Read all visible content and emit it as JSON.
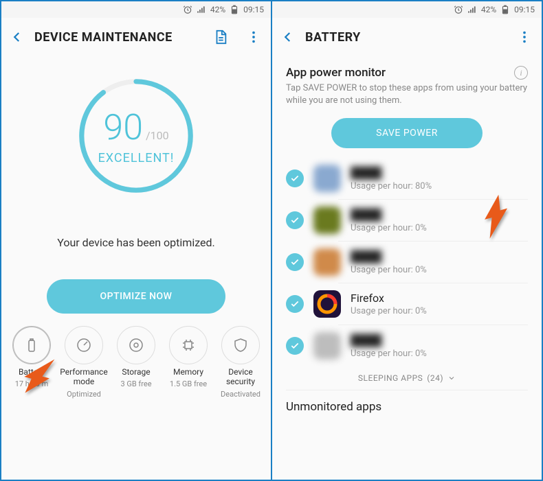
{
  "statusbar": {
    "battery_pct": "42%",
    "time": "09:15"
  },
  "left": {
    "title": "DEVICE MAINTENANCE",
    "score": "90",
    "score_max": "/100",
    "score_label": "EXCELLENT!",
    "optimized_msg": "Your device has been optimized.",
    "optimize_btn": "OPTIMIZE NOW",
    "categories": [
      {
        "label": "Battery",
        "sub": "17 h 10 m"
      },
      {
        "label": "Performance mode",
        "sub": "Optimized"
      },
      {
        "label": "Storage",
        "sub": "3 GB free"
      },
      {
        "label": "Memory",
        "sub": "1.5 GB free"
      },
      {
        "label": "Device security",
        "sub": "Deactivated"
      }
    ]
  },
  "right": {
    "title": "BATTERY",
    "section_title": "App power monitor",
    "section_sub": "Tap SAVE POWER to stop these apps from using your battery while you are not using them.",
    "save_btn": "SAVE POWER",
    "usage_label": "Usage per hour:",
    "apps": [
      {
        "name": "",
        "usage": "80%",
        "blurred": true,
        "color": "#8aa9d0"
      },
      {
        "name": "",
        "usage": "0%",
        "blurred": true,
        "color": "#6a7a1f"
      },
      {
        "name": "",
        "usage": "0%",
        "blurred": true,
        "color": "#d08a4a"
      },
      {
        "name": "Firefox",
        "usage": "0%",
        "blurred": false,
        "color": "#20123a"
      },
      {
        "name": "",
        "usage": "0%",
        "blurred": true,
        "color": "#bdbdbd"
      }
    ],
    "sleeping_label": "SLEEPING APPS",
    "sleeping_count": "(24)",
    "unmonitored": "Unmonitored apps"
  }
}
